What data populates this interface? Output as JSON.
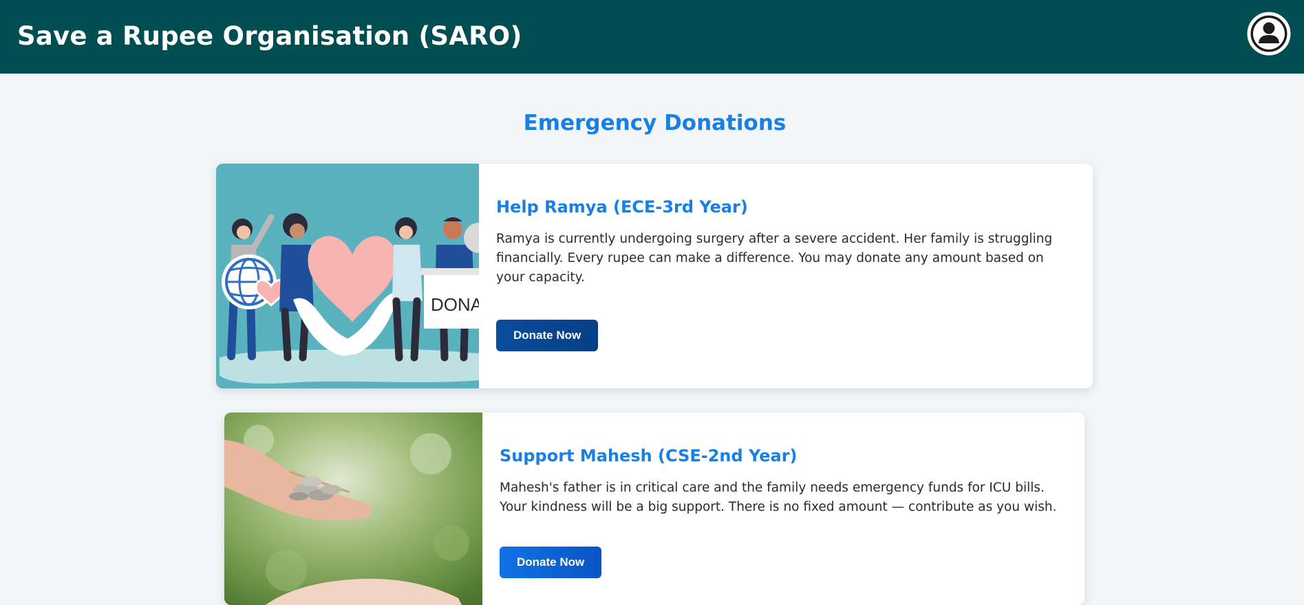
{
  "header": {
    "title": "Save a Rupee Organisation (SARO)",
    "avatar_icon": "user-circle-icon"
  },
  "main": {
    "section_title": "Emergency Donations",
    "cards": [
      {
        "title": "Help Ramya (ECE-3rd Year)",
        "description": "Ramya is currently undergoing surgery after a severe accident. Her family is struggling financially. Every rupee can make a difference. You may donate any amount based on your capacity.",
        "button_label": "Donate Now",
        "image": {
          "description": "illustration of people holding a heart, globe and donation box",
          "sign_text": "DONAT"
        }
      },
      {
        "title": "Support Mahesh (CSE-2nd Year)",
        "description": "Mahesh's father is in critical care and the family needs emergency funds for ICU bills. Your kindness will be a big support. There is no fixed amount — contribute as you wish.",
        "button_label": "Donate Now",
        "image": {
          "description": "photo of hands passing coins over a blurred green background"
        }
      }
    ]
  },
  "colors": {
    "header_bg": "#004e52",
    "page_bg": "#f3f6f8",
    "accent_blue": "#1a7fe3",
    "button_dark_blue": "#0a4c9c",
    "button_blue": "#1073e4"
  }
}
